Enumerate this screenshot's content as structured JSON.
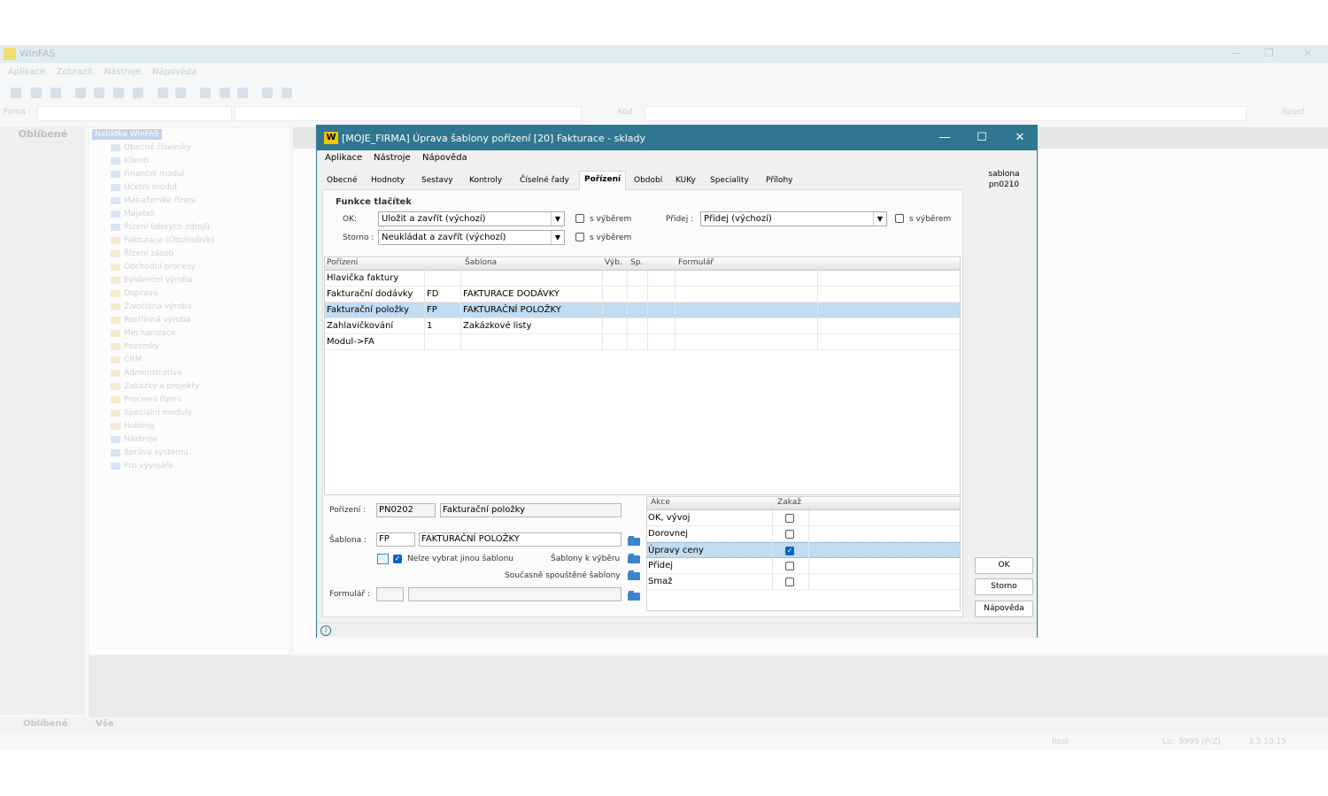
{
  "background": {
    "app_title": "WinFAS",
    "menu": [
      "Aplikace",
      "Zobrazit",
      "Nástroje",
      "Nápověda"
    ],
    "firm_label": "Firma :",
    "kod_label": "Kód :",
    "run_label": "Spusť",
    "left_header": "Oblíbené",
    "tree_root": "Nabídka WinFAS",
    "tree_items": [
      "Obecné číselníky",
      "Klienti",
      "Finanční modul",
      "Účetní modul",
      "Manažerské řízení",
      "Majetek",
      "Řízení lidských zdrojů",
      "Fakturace (Obchodník)",
      "Řízení zásob",
      "Obchodní procesy",
      "Evidenční výroba",
      "Doprava",
      "Živočišná výroba",
      "Rostlinná výroba",
      "Mechanizace",
      "Pozemky",
      "CRM",
      "Administrativa",
      "Zakázky a projekty",
      "Procesní řízení",
      "Speciální moduly",
      "Holding",
      "Nástroje",
      "Správa systému",
      "Pro vývojáře"
    ],
    "bottom_tabs": [
      "Oblíbené",
      "Vše"
    ],
    "status_user": "host",
    "status_lic": "Lic: 9999 (P/Z)",
    "status_version": "3.3.10.15"
  },
  "dialog": {
    "logo": "W",
    "title": "[MOJE_FIRMA] Úprava šablony pořízení [20] Fakturace - sklady",
    "menu": [
      "Aplikace",
      "Nástroje",
      "Nápověda"
    ],
    "side_info": [
      "sablona",
      "pn0210"
    ],
    "tabs": [
      "Obecné",
      "Hodnoty",
      "Sestavy",
      "Kontroly",
      "Číselné řady",
      "Pořízení",
      "Období",
      "KUKy",
      "Speciality",
      "Přílohy"
    ],
    "active_tab": "Pořízení",
    "section_title": "Funkce tlačítek",
    "ok_label": "OK:",
    "ok_value": "Uložit a zavřít (výchozí)",
    "storno_label": "Storno :",
    "storno_value": "Neukládat a zavřít (výchozí)",
    "with_selection": "s výběrem",
    "pridej_label": "Přidej :",
    "pridej_value": "Přidej (výchozí)",
    "grid": {
      "columns": [
        "Pořízení",
        "Šablona",
        "Výb.",
        "Sp.",
        "Formulář"
      ],
      "rows": [
        {
          "name": "Hlavička faktury",
          "code": "",
          "sablona": ""
        },
        {
          "name": "Fakturační dodávky",
          "code": "FD",
          "sablona": "FAKTURACE DODÁVKY"
        },
        {
          "name": "Fakturační položky",
          "code": "FP",
          "sablona": "FAKTURAČNÍ POLOŽKY"
        },
        {
          "name": "Zahlavičkování",
          "code": "1",
          "sablona": "Zakázkové listy"
        },
        {
          "name": "Modul->FA",
          "code": "",
          "sablona": ""
        }
      ],
      "selected_index": 2
    },
    "porizeni_label": "Pořízení :",
    "porizeni_code": "PN0202",
    "porizeni_name": "Fakturační položky",
    "sablona_label": "Šablona :",
    "sablona_code": "FP",
    "sablona_name": "FAKTURAČNÍ POLOŽKY",
    "nelze_label": "Nelze vybrat jinou šablonu",
    "sablony_k_vyberu": "Šablony k výběru",
    "soucasne": "Současně spouštěné šablony",
    "formular_label": "Formulář :",
    "actions": {
      "columns": [
        "Akce",
        "Zakaž"
      ],
      "rows": [
        {
          "label": "OK, vývoj",
          "checked": false
        },
        {
          "label": "Dorovnej",
          "checked": false
        },
        {
          "label": "Úpravy ceny",
          "checked": true
        },
        {
          "label": "Přidej",
          "checked": false
        },
        {
          "label": "Smaž",
          "checked": false
        }
      ],
      "selected_index": 2
    },
    "buttons": {
      "ok": "OK",
      "storno": "Storno",
      "help": "Nápověda"
    }
  }
}
